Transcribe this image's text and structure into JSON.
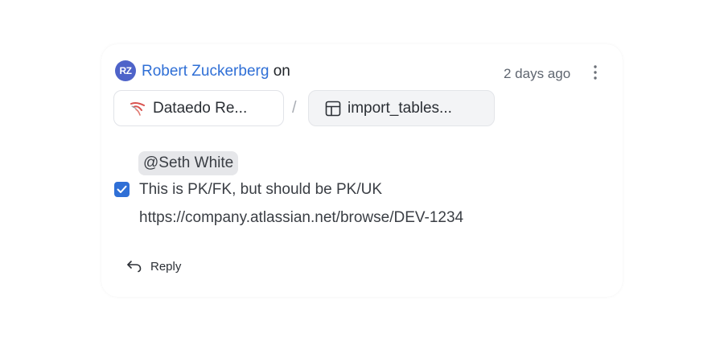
{
  "comment": {
    "avatar_initials": "RZ",
    "author": "Robert Zuckerberg",
    "on_label": "on",
    "timestamp": "2 days ago",
    "database_chip": "Dataedo Re...",
    "separator": "/",
    "table_chip": "import_tables...",
    "mention": "@Seth White",
    "task": {
      "checked": true,
      "text": "This is PK/FK, but should be PK/UK"
    },
    "link": "https://company.atlassian.net/browse/DEV-1234",
    "reply_label": "Reply"
  },
  "colors": {
    "accent": "#2f6fd6",
    "avatar_bg": "#4e63c9",
    "mention_bg": "#e6e7ea",
    "database_icon": "#d9534f"
  },
  "icons": {
    "menu": "kebab-vertical-icon",
    "database": "dataedo-database-icon",
    "table": "table-grid-icon",
    "reply": "reply-arrow-icon",
    "checkbox": "checkmark-icon"
  }
}
